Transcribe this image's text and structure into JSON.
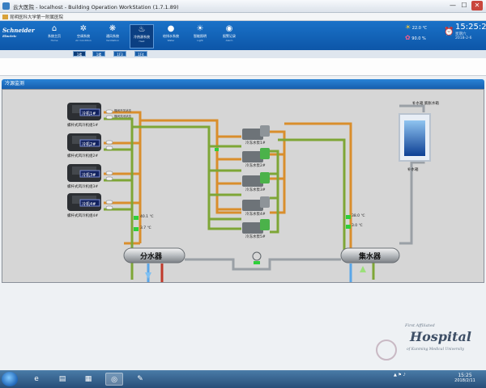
{
  "window": {
    "title": "云大医院 - localhost - Building Operation WorkStation (1.7.1.89)",
    "min": "—",
    "max": "☐",
    "close": "✕"
  },
  "addressbar": {
    "text": "昆明医科大学第一附属医院"
  },
  "header": {
    "logo_main": "Schneider",
    "logo_sub": "Electric"
  },
  "nav": [
    {
      "icon": "home-icon",
      "glyph": "⌂",
      "label": "系统主页",
      "sub": "Home"
    },
    {
      "icon": "air-conditioning-icon",
      "glyph": "✲",
      "label": "空调系统",
      "sub": "Air Condition"
    },
    {
      "icon": "ventilation-icon",
      "glyph": "❋",
      "label": "通风系统",
      "sub": "Ventilation"
    },
    {
      "icon": "heat-source-icon",
      "glyph": "♨",
      "label": "冷热源系统",
      "sub": "Heat"
    },
    {
      "icon": "water-drop-icon",
      "glyph": "💧",
      "label": "给排水系统",
      "sub": "Water"
    },
    {
      "icon": "lighting-icon",
      "glyph": "☀",
      "label": "智能照明",
      "sub": "Light"
    },
    {
      "icon": "alarm-icon",
      "glyph": "◉",
      "label": "报警记录",
      "sub": "Alarm"
    }
  ],
  "weather": {
    "temp": "22.0",
    "temp_unit": "℃",
    "humidity": "90.0",
    "humidity_unit": "%"
  },
  "clock": {
    "time": "15:25:22",
    "weekday": "星期六",
    "date": "2018-2-6"
  },
  "subtabs": [
    "1楼",
    "1楼",
    "1F3",
    "1F4"
  ],
  "panel_title": "冷源监测",
  "diagram": {
    "chillers": [
      {
        "tag": "冷机1#",
        "name": "螺杆式风冷机组1#"
      },
      {
        "tag": "冷机2#",
        "name": "螺杆式风冷机组2#"
      },
      {
        "tag": "冷机3#",
        "name": "螺杆式风冷机组3#"
      },
      {
        "tag": "冷机4#",
        "name": "螺杆式风冷机组4#"
      }
    ],
    "valve_labels": [
      "蝶阀开关状态",
      "蝶阀关闭状态"
    ],
    "pumps": [
      "冷冻水泵1#",
      "冷冻水泵2#",
      "冷冻水泵3#",
      "冷冻水泵4#",
      "冷冻水泵5#"
    ],
    "supply_temp": "40.1 ℃",
    "return_temp": "3.7 ℃",
    "collector_temp1": "38.0 ℃",
    "collector_temp2": "3.0 ℃",
    "distributor": "分水器",
    "collector": "集水器",
    "tank_label_top": "补水箱 膨胀水箱",
    "tank_label_bottom": "补水箱",
    "colors": {
      "pipe_orange": "#d98e2c",
      "pipe_green": "#7ea636",
      "pipe_gray": "#9aa0a6"
    }
  },
  "watermark": {
    "line1": "First Affiliated",
    "line2": "Hospital",
    "line3": "of Kunming Medical University"
  },
  "taskbar": {
    "items": [
      "start",
      "ie",
      "folder",
      "workstation",
      "media",
      "paint"
    ],
    "time": "15:25",
    "date": "2018/2/11"
  }
}
